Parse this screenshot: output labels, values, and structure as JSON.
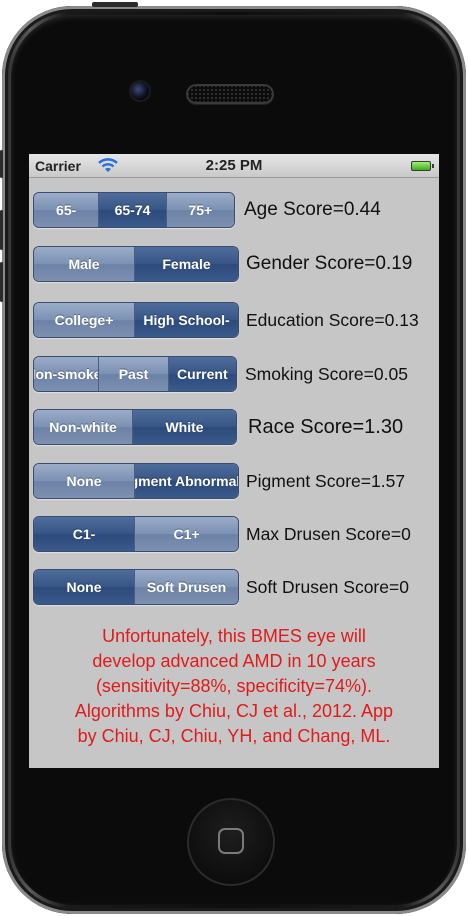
{
  "status_bar": {
    "carrier": "Carrier",
    "time": "2:25 PM"
  },
  "rows": [
    {
      "options": [
        "65-",
        "65-74",
        "75+"
      ],
      "selected": 1,
      "score_label": "Age Score=0.44"
    },
    {
      "options": [
        "Male",
        "Female"
      ],
      "selected": 1,
      "score_label": "Gender Score=0.19"
    },
    {
      "options": [
        "College+",
        "High School-"
      ],
      "selected": 1,
      "score_label": "Education Score=0.13"
    },
    {
      "options": [
        "Non-smoker",
        "Past",
        "Current"
      ],
      "selected": 2,
      "score_label": "Smoking Score=0.05"
    },
    {
      "options": [
        "Non-white",
        "White"
      ],
      "selected": 1,
      "score_label": "Race Score=1.30"
    },
    {
      "options": [
        "None",
        "Pigment Abnormality"
      ],
      "selected": 1,
      "score_label": "Pigment Score=1.57"
    },
    {
      "options": [
        "C1-",
        "C1+"
      ],
      "selected": 0,
      "score_label": "Max Drusen Score=0"
    },
    {
      "options": [
        "None",
        "Soft Drusen"
      ],
      "selected": 0,
      "score_label": "Soft Drusen Score=0"
    }
  ],
  "message_lines": [
    "Unfortunately, this BMES eye will",
    "develop advanced AMD in 10 years",
    "(sensitivity=88%, specificity=74%).",
    "Algorithms by Chiu, CJ et al., 2012. App",
    "by Chiu, CJ, Chiu, YH, and Chang, ML."
  ],
  "colors": {
    "message": "#e01b1b",
    "selected_segment": "#365585",
    "unselected_segment": "#7b91b3",
    "screen_bg": "#c6c6c6"
  },
  "icons": {
    "wifi": "wifi-icon",
    "battery": "battery-icon"
  }
}
